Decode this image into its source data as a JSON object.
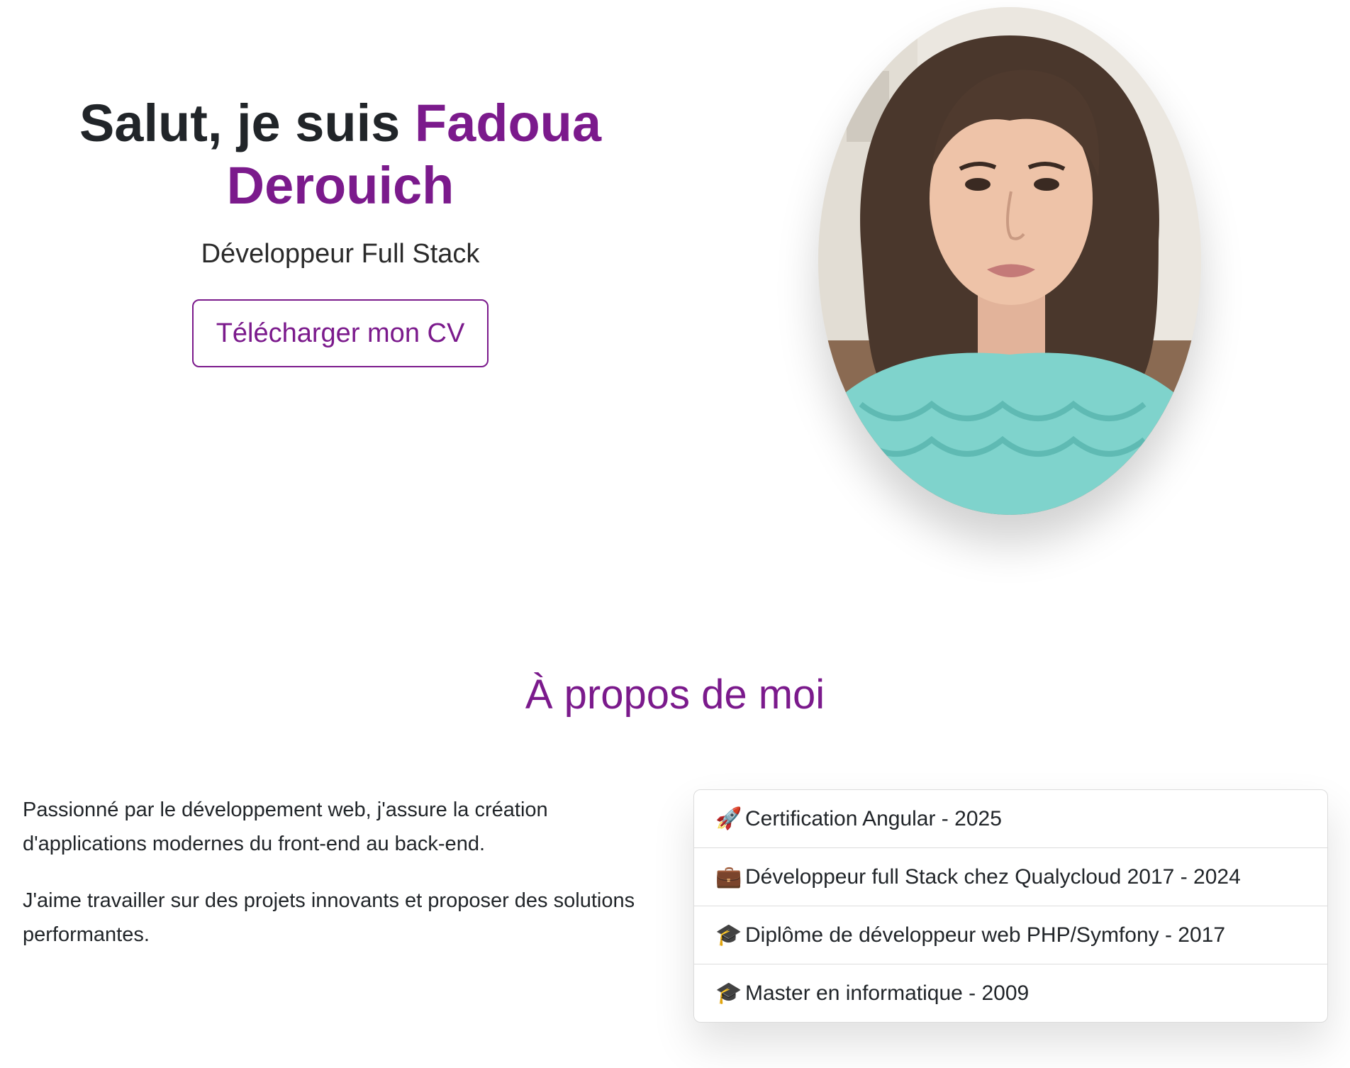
{
  "hero": {
    "title_prefix": "Salut, je suis ",
    "title_name": "Fadoua Derouich",
    "subtitle": "Développeur Full Stack",
    "cv_button_label": "Télécharger mon CV",
    "accent_color": "#7b1a8c"
  },
  "about": {
    "heading": "À propos de moi",
    "paragraphs": [
      "Passionné par le développement web, j'assure la création d'applications modernes du front-end au back-end.",
      "J'aime travailler sur des projets innovants et proposer des solutions performantes."
    ],
    "timeline": [
      {
        "icon": "rocket-icon",
        "glyph": "🚀",
        "label": "Certification Angular - 2025"
      },
      {
        "icon": "briefcase-icon",
        "glyph": "💼",
        "label": "Développeur full Stack chez Qualycloud 2017 - 2024"
      },
      {
        "icon": "graduation-cap-icon",
        "glyph": "🎓",
        "label": "Diplôme de développeur web PHP/Symfony - 2017"
      },
      {
        "icon": "graduation-cap-icon",
        "glyph": "🎓",
        "label": "Master en informatique - 2009"
      }
    ]
  }
}
